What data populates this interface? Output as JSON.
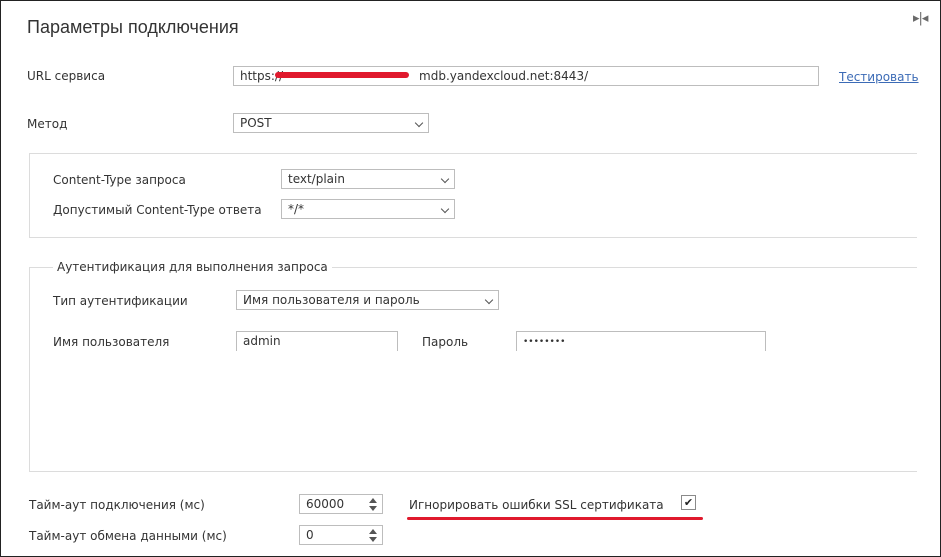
{
  "dialog": {
    "title": "Параметры подключения",
    "panel_toggle_icon": "collapse-panel-icon"
  },
  "url": {
    "label": "URL сервиса",
    "value_prefix": "https://",
    "value_suffix": "mdb.yandexcloud.net:8443/",
    "test_link": "Тестировать"
  },
  "method": {
    "label": "Метод",
    "selected": "POST"
  },
  "content_type": {
    "request_label": "Content-Type запроса",
    "request_selected": "text/plain",
    "response_label": "Допустимый Content-Type ответа",
    "response_selected": "*/*"
  },
  "auth": {
    "legend": "Аутентификация для выполнения запроса",
    "type_label": "Тип аутентификации",
    "type_selected": "Имя пользователя и пароль",
    "username_label": "Имя пользователя",
    "username_value": "admin",
    "password_label": "Пароль",
    "password_value": "••••••••"
  },
  "timeouts": {
    "connect_label": "Тайм-аут подключения (мс)",
    "connect_value": "60000",
    "exchange_label": "Тайм-аут обмена данными (мс)",
    "exchange_value": "0"
  },
  "ssl": {
    "label": "Игнорировать ошибки SSL сертификата",
    "checked": true,
    "check_mark": "✔"
  },
  "colors": {
    "link": "#3c6bb6",
    "annotation_red": "#e0192d",
    "border": "#bdbdbd"
  }
}
